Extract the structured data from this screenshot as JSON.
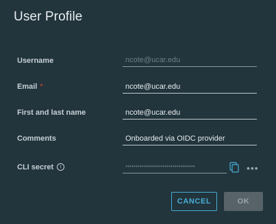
{
  "dialog": {
    "title": "User Profile"
  },
  "form": {
    "username": {
      "label": "Username",
      "value": "ncote@ucar.edu"
    },
    "email": {
      "label": "Email",
      "required_marker": "*",
      "value": "ncote@ucar.edu"
    },
    "name": {
      "label": "First and last name",
      "value": "ncote@ucar.edu"
    },
    "comments": {
      "label": "Comments",
      "value": "Onboarded via OIDC provider"
    },
    "cli_secret": {
      "label": "CLI secret",
      "info_glyph": "i",
      "masked_value": "••••••••••••••••••••••••••••••••••",
      "more_glyph": "•••"
    }
  },
  "icons": {
    "info": "info-icon",
    "copy": "copy-icon",
    "more": "more-horizontal-icon"
  },
  "footer": {
    "cancel_label": "CANCEL",
    "ok_label": "OK"
  },
  "colors": {
    "background": "#22343c",
    "accent": "#49afd9",
    "required": "#e0462f",
    "ok_disabled": "#576269"
  }
}
